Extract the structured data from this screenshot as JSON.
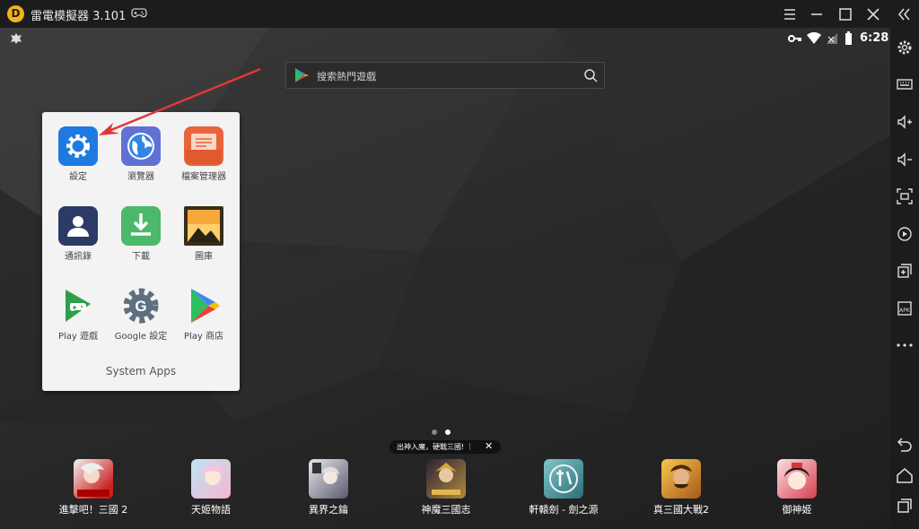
{
  "window": {
    "title": "雷電模擬器 3.101",
    "logo_letter": "D"
  },
  "status": {
    "time": "6:28"
  },
  "search": {
    "placeholder": "搜索熱門遊戲"
  },
  "folder": {
    "name": "System Apps",
    "apps": [
      {
        "label": "設定",
        "icon": "settings-icon"
      },
      {
        "label": "瀏覽器",
        "icon": "browser-icon"
      },
      {
        "label": "檔案管理器",
        "icon": "file-manager-icon"
      },
      {
        "label": "通訊錄",
        "icon": "contacts-icon"
      },
      {
        "label": "下載",
        "icon": "download-icon"
      },
      {
        "label": "圖庫",
        "icon": "gallery-icon"
      },
      {
        "label": "Play 遊戲",
        "icon": "play-games-icon"
      },
      {
        "label": "Google 設定",
        "icon": "google-settings-icon"
      },
      {
        "label": "Play 商店",
        "icon": "play-store-icon"
      }
    ]
  },
  "toast": {
    "text": "出神入魔，硬戰三國! ｜",
    "close": "✕"
  },
  "dock": [
    {
      "label": "進擊吧！三國 2"
    },
    {
      "label": "天姬物語"
    },
    {
      "label": "異界之鑰"
    },
    {
      "label": "神魔三國志"
    },
    {
      "label": "軒轅劍 - 劍之源"
    },
    {
      "label": "真三國大戰2"
    },
    {
      "label": "御神姬"
    }
  ],
  "colors": {
    "accent_arrow": "#e0383a",
    "settings_blue": "#1f7ae0",
    "file_orange": "#e8643c"
  }
}
